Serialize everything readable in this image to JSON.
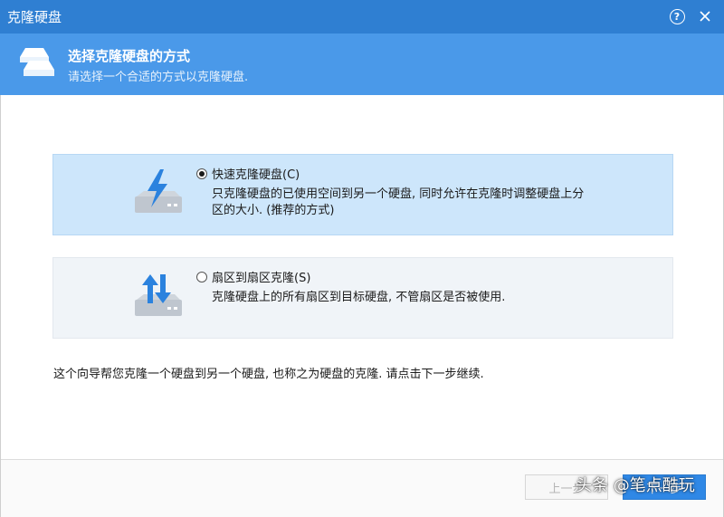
{
  "window": {
    "title": "克隆硬盘",
    "help_label": "?"
  },
  "header": {
    "title": "选择克隆硬盘的方式",
    "subtitle": "请选择一个合适的方式以克隆硬盘."
  },
  "options": [
    {
      "label": "快速克隆硬盘(C)",
      "description": "只克隆硬盘的已使用空间到另一个硬盘, 同时允许在克隆时调整硬盘上分区的大小. (推荐的方式)",
      "selected": true,
      "icon": "fast-clone-disk-icon"
    },
    {
      "label": "扇区到扇区克隆(S)",
      "description": "克隆硬盘上的所有扇区到目标硬盘, 不管扇区是否被使用.",
      "selected": false,
      "icon": "sector-clone-disk-icon"
    }
  ],
  "info_text": "这个向导帮您克隆一个硬盘到另一个硬盘, 也称之为硬盘的克隆. 请点击下一步继续.",
  "buttons": {
    "prev": "上一步",
    "next": "下一步"
  },
  "watermark": "头条 @笔点酷玩",
  "colors": {
    "titlebar": "#2f7fd2",
    "header": "#4a99e9",
    "selected_option": "#cde6fb",
    "option": "#f0f4f8",
    "accent_icon": "#2b82de",
    "disk_gray": "#bfc6cf"
  }
}
